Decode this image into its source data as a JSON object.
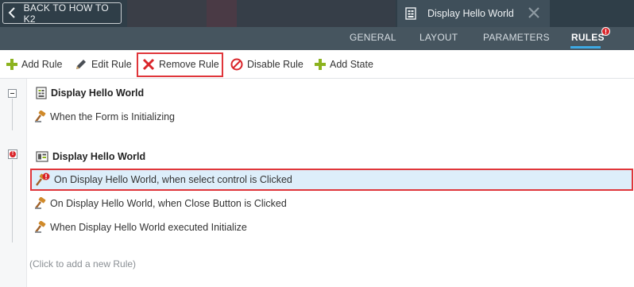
{
  "header": {
    "back_label": "BACK TO HOW TO K2",
    "form_tab_title": "Display Hello World",
    "alert_badge": "!"
  },
  "nav": {
    "tabs": [
      {
        "label": "GENERAL"
      },
      {
        "label": "LAYOUT"
      },
      {
        "label": "PARAMETERS"
      },
      {
        "label": "RULES",
        "active": true
      }
    ]
  },
  "toolbar": {
    "add_rule": "Add Rule",
    "edit_rule": "Edit Rule",
    "remove_rule": "Remove Rule",
    "disable_rule": "Disable Rule",
    "add_state": "Add State"
  },
  "groups": [
    {
      "title": "Display Hello World",
      "icon": "form-icon",
      "rules": [
        {
          "label": "When the Form is Initializing"
        }
      ]
    },
    {
      "title": "Display Hello World",
      "icon": "view-icon",
      "status": "error",
      "rules": [
        {
          "label": "On Display Hello World, when select control is Clicked",
          "selected": true,
          "error": true
        },
        {
          "label": "On Display Hello World, when Close Button is Clicked"
        },
        {
          "label": "When Display Hello World executed Initialize"
        }
      ]
    }
  ],
  "add_rule_hint": "(Click to add a new Rule)",
  "colors": {
    "header_bg": "#2f3e48",
    "nav_bg": "#46555f",
    "active_underline": "#3da9e3",
    "highlight_border": "#e0363b",
    "selected_row_bg": "#ddeefa",
    "add_icon": "#8cb31f",
    "remove_icon": "#d9252a"
  }
}
